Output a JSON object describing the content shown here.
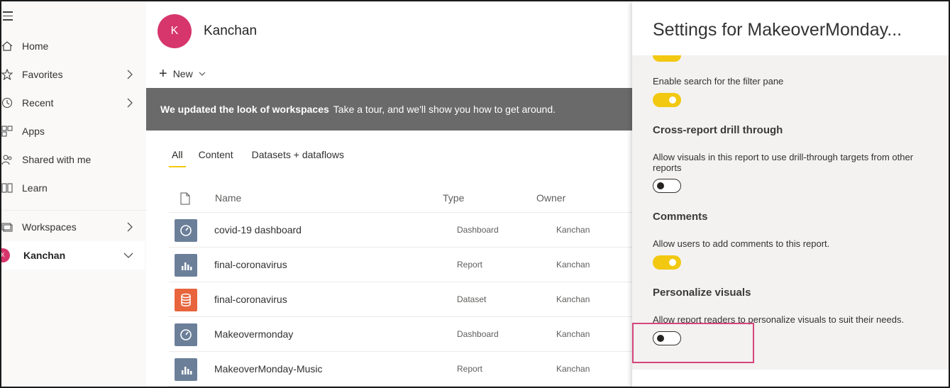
{
  "nav": {
    "items": [
      {
        "label": "Home",
        "icon": "home-icon",
        "chevron": false
      },
      {
        "label": "Favorites",
        "icon": "star-icon",
        "chevron": true
      },
      {
        "label": "Recent",
        "icon": "clock-icon",
        "chevron": true
      },
      {
        "label": "Apps",
        "icon": "apps-icon",
        "chevron": false
      },
      {
        "label": "Shared with me",
        "icon": "shared-icon",
        "chevron": false
      },
      {
        "label": "Learn",
        "icon": "book-icon",
        "chevron": false
      }
    ],
    "workspaces_label": "Workspaces",
    "current_workspace": {
      "label": "Kanchan",
      "avatar_letter": "K"
    }
  },
  "workspace": {
    "title": "Kanchan",
    "avatar_letter": "K",
    "new_label": "New"
  },
  "banner": {
    "bold": "We updated the look of workspaces",
    "text": "Take a tour, and we'll show you how to get around."
  },
  "tabs": [
    "All",
    "Content",
    "Datasets + dataflows"
  ],
  "table": {
    "columns": [
      "Name",
      "Type",
      "Owner"
    ],
    "rows": [
      {
        "name": "covid-19 dashboard",
        "type": "Dashboard",
        "owner": "Kanchan",
        "icon": "dashboard-icon"
      },
      {
        "name": "final-coronavirus",
        "type": "Report",
        "owner": "Kanchan",
        "icon": "report-icon"
      },
      {
        "name": "final-coronavirus",
        "type": "Dataset",
        "owner": "Kanchan",
        "icon": "dataset-icon"
      },
      {
        "name": "Makeovermonday",
        "type": "Dashboard",
        "owner": "Kanchan",
        "icon": "dashboard-icon"
      },
      {
        "name": "MakeoverMonday-Music",
        "type": "Report",
        "owner": "Kanchan",
        "icon": "report-icon"
      }
    ]
  },
  "settings": {
    "title": "Settings for MakeoverMonday...",
    "filter_search_desc": "Enable search for the filter pane",
    "cross_report": {
      "heading": "Cross-report drill through",
      "desc": "Allow visuals in this report to use drill-through targets from other reports"
    },
    "comments": {
      "heading": "Comments",
      "desc": "Allow users to add comments to this report."
    },
    "personalize": {
      "heading": "Personalize visuals",
      "desc": "Allow report readers to personalize visuals to suit their needs."
    },
    "toggles": {
      "previous_setting": true,
      "filter_search": true,
      "cross_report": false,
      "comments": true,
      "personalize": false
    }
  },
  "colors": {
    "accent_yellow": "#f2c811",
    "avatar_pink": "#d6366b",
    "dashboard_tile": "#6b7f99",
    "report_tile": "#6b7f99",
    "dataset_tile": "#e8643c",
    "banner_gray": "#6a6a6a",
    "highlight_box": "#d6457c"
  }
}
